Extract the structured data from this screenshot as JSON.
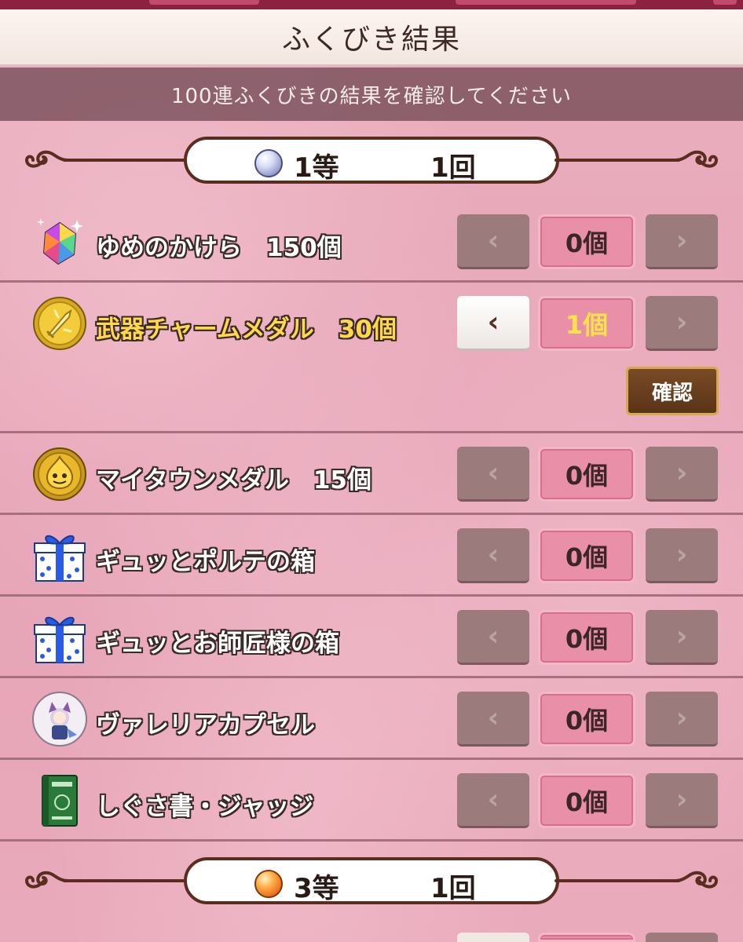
{
  "header": {
    "title": "ふくびき結果",
    "subtitle": "100連ふくびきの結果を確認してください"
  },
  "sections": [
    {
      "rank_label": "1等",
      "rank_count": "1回",
      "gem": "pearl-orb-icon",
      "items": [
        {
          "name": "ゆめのかけら　150個",
          "qty": "0個",
          "icon": "rainbow-crystal-icon",
          "highlight": false
        },
        {
          "name": "武器チャームメダル　30個",
          "qty": "1個",
          "icon": "gold-sword-medal-icon",
          "highlight": true
        },
        {
          "name": "マイタウンメダル　15個",
          "qty": "0個",
          "icon": "gold-slime-medal-icon",
          "highlight": false
        },
        {
          "name": "ギュッとポルテの箱",
          "qty": "0個",
          "icon": "gift-box-icon",
          "highlight": false
        },
        {
          "name": "ギュッとお師匠様の箱",
          "qty": "0個",
          "icon": "gift-box-icon",
          "highlight": false
        },
        {
          "name": "ヴァレリアカプセル",
          "qty": "0個",
          "icon": "character-capsule-icon",
          "highlight": false
        },
        {
          "name": "しぐさ書・ジャッジ",
          "qty": "0個",
          "icon": "green-book-icon",
          "highlight": false
        }
      ]
    },
    {
      "rank_label": "3等",
      "rank_count": "1回",
      "gem": "orange-orb-icon"
    }
  ],
  "buttons": {
    "prev": "‹",
    "next": "›",
    "confirm": "確認"
  },
  "colors": {
    "background": "#e9a9b9",
    "qty_gold": "#ffe34a",
    "name_gold": "#ffd84a",
    "confirm_border": "#d8a94a"
  }
}
